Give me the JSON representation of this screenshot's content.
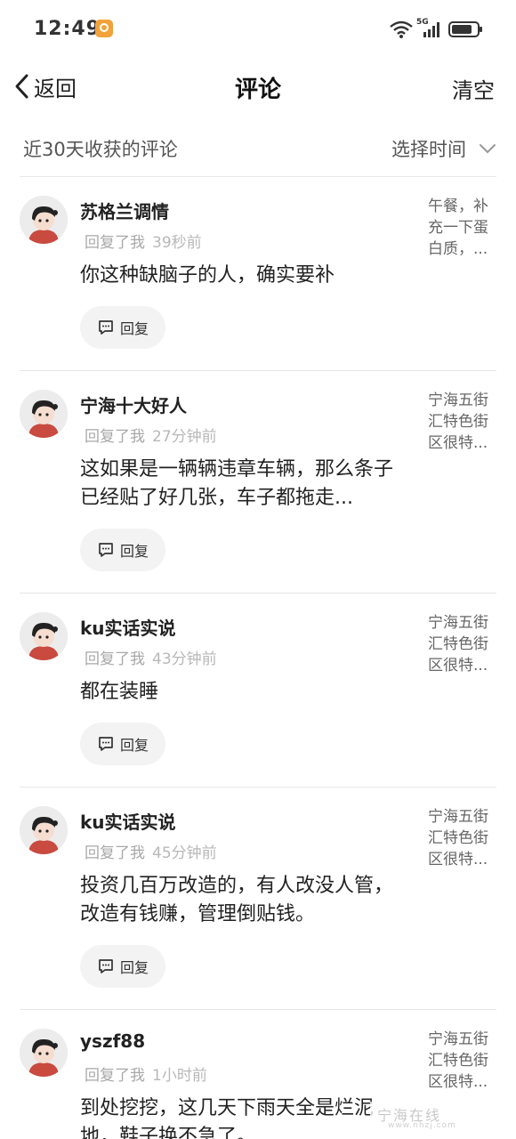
{
  "status_bar": {
    "time": "12:49",
    "network": "5G"
  },
  "nav": {
    "back_label": "返回",
    "title": "评论",
    "clear_label": "清空"
  },
  "filter": {
    "label": "近30天收获的评论",
    "select_label": "选择时间"
  },
  "reply_button_label": "回复",
  "comments": [
    {
      "user": "苏格兰调情",
      "action": "回复了我",
      "time": "39秒前",
      "content": "你这种缺脑子的人，确实要补",
      "source": "午餐，补充一下蛋白质，..."
    },
    {
      "user": "宁海十大好人",
      "action": "回复了我",
      "time": "27分钟前",
      "content": "这如果是一辆辆违章车辆，那么条子已经贴了好几张，车子都拖走...",
      "source": "宁海五街汇特色街区很特..."
    },
    {
      "user": "ku实话实说",
      "action": "回复了我",
      "time": "43分钟前",
      "content": "都在装睡",
      "source": "宁海五街汇特色街区很特..."
    },
    {
      "user": "ku实话实说",
      "action": "回复了我",
      "time": "45分钟前",
      "content": "投资几百万改造的，有人改没人管，改造有钱赚，管理倒贴钱。",
      "source": "宁海五街汇特色街区很特..."
    },
    {
      "user": "yszf88",
      "action": "回复了我",
      "time": "1小时前",
      "content": "到处挖挖，这几天下雨天全是烂泥地，鞋子换不急了。",
      "source": "宁海五街汇特色街区很特..."
    }
  ],
  "watermark": {
    "text": "宁海在线",
    "sub": "www.nhzj.com"
  }
}
